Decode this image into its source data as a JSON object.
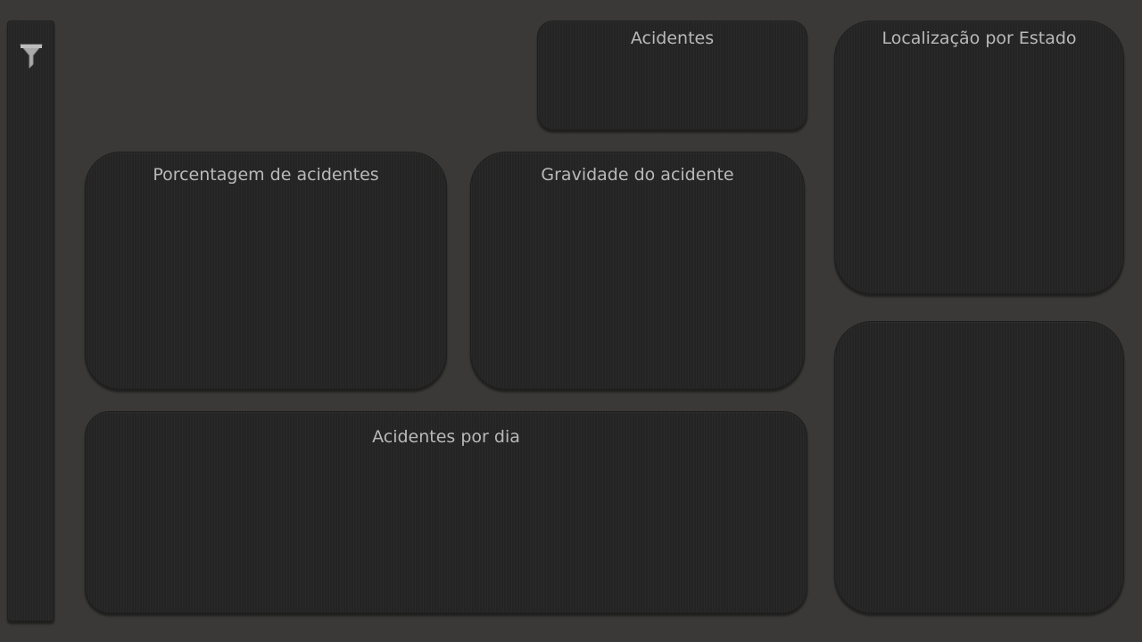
{
  "panels": {
    "acidentes": {
      "title": "Acidentes"
    },
    "localizacao": {
      "title": "Localização por Estado"
    },
    "porcentagem": {
      "title": "Porcentagem de acidentes"
    },
    "gravidade": {
      "title": "Gravidade do acidente"
    },
    "por_dia": {
      "title": "Acidentes por dia"
    }
  },
  "sidebar": {
    "icon": "filter-icon"
  },
  "colors": {
    "background": "#3a3937",
    "panel": "#252525",
    "title_text": "#b9b9b9",
    "icon": "#a9a9a9"
  }
}
